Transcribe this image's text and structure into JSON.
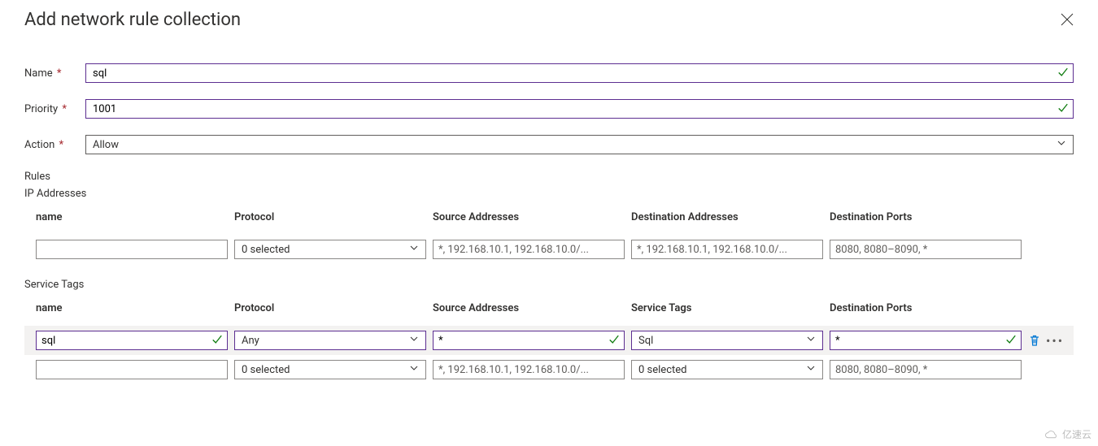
{
  "header": {
    "title": "Add network rule collection"
  },
  "form": {
    "name_label": "Name",
    "name_value": "sql",
    "priority_label": "Priority",
    "priority_value": "1001",
    "action_label": "Action",
    "action_value": "Allow"
  },
  "rules": {
    "section_label": "Rules",
    "ip_addresses": {
      "label": "IP Addresses",
      "columns": {
        "name": "name",
        "protocol": "Protocol",
        "source": "Source Addresses",
        "destination": "Destination Addresses",
        "ports": "Destination Ports"
      },
      "rows": [
        {
          "name_value": "",
          "protocol_value": "0 selected",
          "source_placeholder": "*, 192.168.10.1, 192.168.10.0/...",
          "destination_placeholder": "*, 192.168.10.1, 192.168.10.0/...",
          "ports_placeholder": "8080, 8080–8090, *"
        }
      ]
    },
    "service_tags": {
      "label": "Service Tags",
      "columns": {
        "name": "name",
        "protocol": "Protocol",
        "source": "Source Addresses",
        "tags": "Service Tags",
        "ports": "Destination Ports"
      },
      "rows": [
        {
          "name_value": "sql",
          "protocol_value": "Any",
          "source_value": "*",
          "tags_value": "Sql",
          "ports_value": "*",
          "valid": true,
          "has_actions": true
        },
        {
          "name_value": "",
          "protocol_value": "0 selected",
          "source_placeholder": "*, 192.168.10.1, 192.168.10.0/...",
          "tags_value": "0 selected",
          "ports_placeholder": "8080, 8080–8090, *",
          "valid": false,
          "has_actions": false
        }
      ]
    }
  },
  "watermark": "亿速云"
}
